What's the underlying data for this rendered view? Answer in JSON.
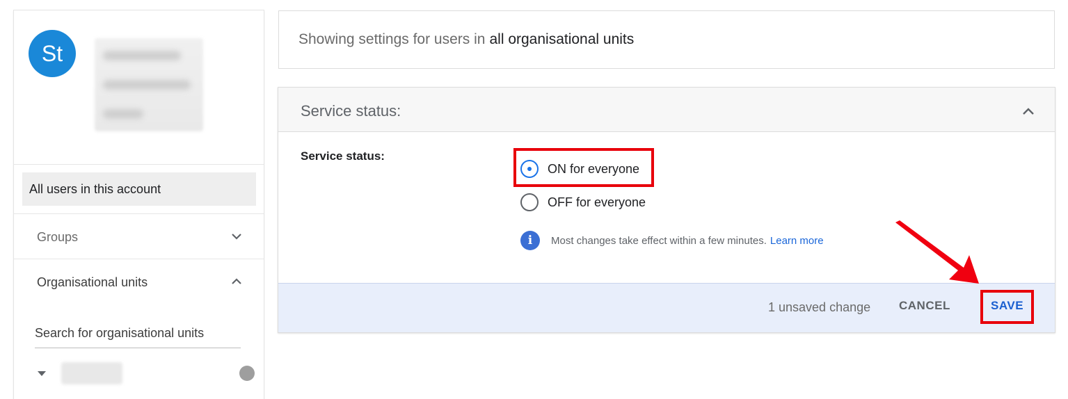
{
  "sidebar": {
    "avatar_initials": "St",
    "all_users_label": "All users in this account",
    "groups_label": "Groups",
    "org_units_label": "Organisational units",
    "search_placeholder": "Search for organisational units"
  },
  "header": {
    "prefix": "Showing settings for users in",
    "scope": "all organisational units"
  },
  "service": {
    "section_title": "Service status:",
    "field_label": "Service status:",
    "options": [
      {
        "label": "ON for everyone",
        "selected": true
      },
      {
        "label": "OFF for everyone",
        "selected": false
      }
    ],
    "info_text": "Most changes take effect within a few minutes.",
    "learn_more": "Learn more"
  },
  "footer": {
    "unsaved": "1 unsaved change",
    "cancel": "CANCEL",
    "save": "SAVE"
  },
  "colors": {
    "accent": "#1a73e8",
    "avatar": "#1a88d8",
    "highlight": "#e8000b",
    "footer_bg": "#e8eefb"
  },
  "icons": {
    "groups": "chevron-down-icon",
    "org_units": "chevron-up-icon",
    "section": "chevron-up-icon",
    "info": "info-icon",
    "annotation": "red-arrow-icon"
  }
}
